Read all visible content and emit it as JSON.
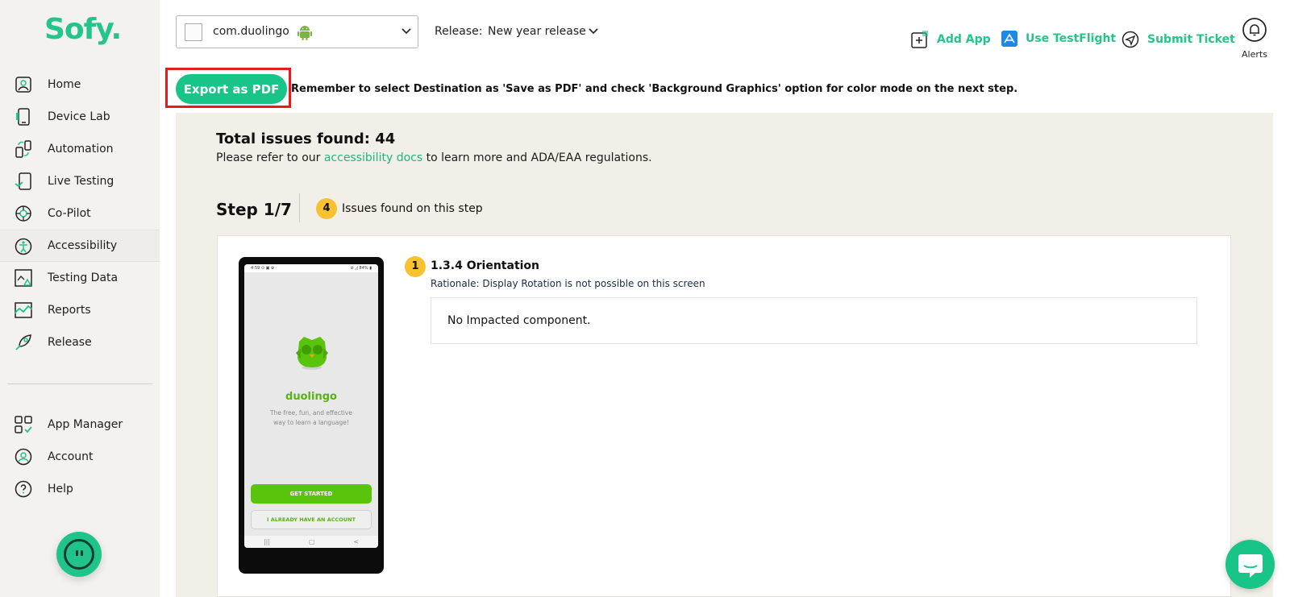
{
  "brand": {
    "logo": "Sofy.",
    "accent": "#25c48a"
  },
  "sidebar": {
    "items": [
      {
        "label": "Home",
        "icon": "home-icon"
      },
      {
        "label": "Device Lab",
        "icon": "device-icon"
      },
      {
        "label": "Automation",
        "icon": "automation-icon"
      },
      {
        "label": "Live Testing",
        "icon": "live-testing-icon"
      },
      {
        "label": "Co-Pilot",
        "icon": "copilot-icon"
      },
      {
        "label": "Accessibility",
        "icon": "accessibility-icon",
        "active": true
      },
      {
        "label": "Testing Data",
        "icon": "testing-data-icon"
      },
      {
        "label": "Reports",
        "icon": "reports-icon"
      },
      {
        "label": "Release",
        "icon": "release-icon"
      }
    ],
    "bottom_items": [
      {
        "label": "App Manager",
        "icon": "app-manager-icon"
      },
      {
        "label": "Account",
        "icon": "account-icon"
      },
      {
        "label": "Help",
        "icon": "help-icon"
      }
    ]
  },
  "topbar": {
    "app_name": "com.duolingo",
    "release_label": "Release:",
    "release_value": "New year release",
    "actions": [
      {
        "label": "Add App",
        "icon": "add-app-icon"
      },
      {
        "label": "Use TestFlight",
        "icon": "testflight-icon"
      },
      {
        "label": "Submit Ticket",
        "icon": "submit-ticket-icon"
      }
    ],
    "alerts_label": "Alerts"
  },
  "export": {
    "button_label": "Export as PDF",
    "note_prefix": "Remember to select Destination as ",
    "note_save": "'Save as PDF'",
    "note_mid": " and check ",
    "note_bg": "'Background Graphics'",
    "note_suffix": " option for color mode on the next step."
  },
  "report": {
    "total_label": "Total issues found: 44",
    "refer_prefix": "Please refer to our ",
    "refer_link": "accessibility docs",
    "refer_suffix": " to learn more and ADA/EAA regulations.",
    "step_label": "Step 1/7",
    "step_issue_count": "4",
    "step_issue_label": "Issues found on this step"
  },
  "phone_preview": {
    "status_left": "4:59 ⊙ ▣ ⊕ ·",
    "status_right": "⊘ ◿ 84% ▮",
    "app_title": "duolingo",
    "tagline": "The free, fun, and effective way to learn a language!",
    "primary_button": "GET STARTED",
    "secondary_button": "I ALREADY HAVE AN ACCOUNT",
    "nav_glyphs": [
      "|||",
      "▢",
      "<"
    ]
  },
  "issue": {
    "number": "1",
    "title": "1.3.4 Orientation",
    "rationale": "Rationale: Display Rotation is not possible on this screen",
    "impact": "No Impacted component."
  }
}
